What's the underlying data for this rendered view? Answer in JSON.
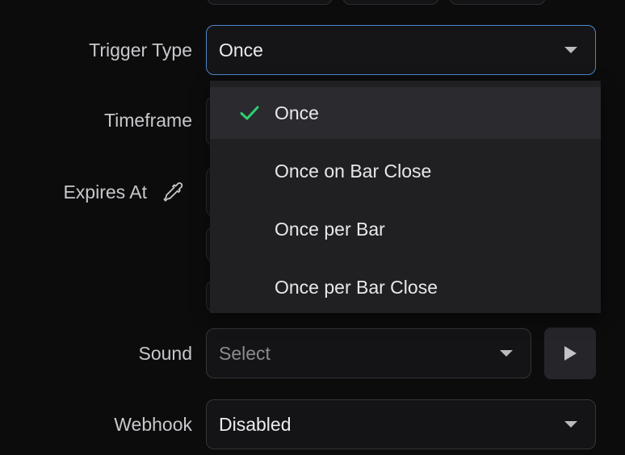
{
  "colors": {
    "background": "#0c0c0d",
    "field_bg": "#141416",
    "focus_border": "#4d86c7",
    "menu_bg": "#202023",
    "menu_selected_bg": "#2b2b2f",
    "check_green": "#2fd072"
  },
  "form": {
    "trigger_type": {
      "label": "Trigger Type",
      "value": "Once",
      "caret_icon": "chevron-down-icon"
    },
    "timeframe": {
      "label": "Timeframe"
    },
    "expires_at": {
      "label": "Expires At",
      "icon": "eyedropper-icon"
    },
    "sound": {
      "label": "Sound",
      "placeholder": "Select",
      "caret_icon": "chevron-down-icon",
      "play_icon": "play-icon"
    },
    "webhook": {
      "label": "Webhook",
      "value": "Disabled",
      "caret_icon": "chevron-down-icon"
    }
  },
  "dropdown": {
    "selected": "Once",
    "check_icon": "checkmark-icon",
    "options": [
      {
        "label": "Once"
      },
      {
        "label": "Once on Bar Close"
      },
      {
        "label": "Once per Bar"
      },
      {
        "label": "Once per Bar Close"
      }
    ]
  }
}
